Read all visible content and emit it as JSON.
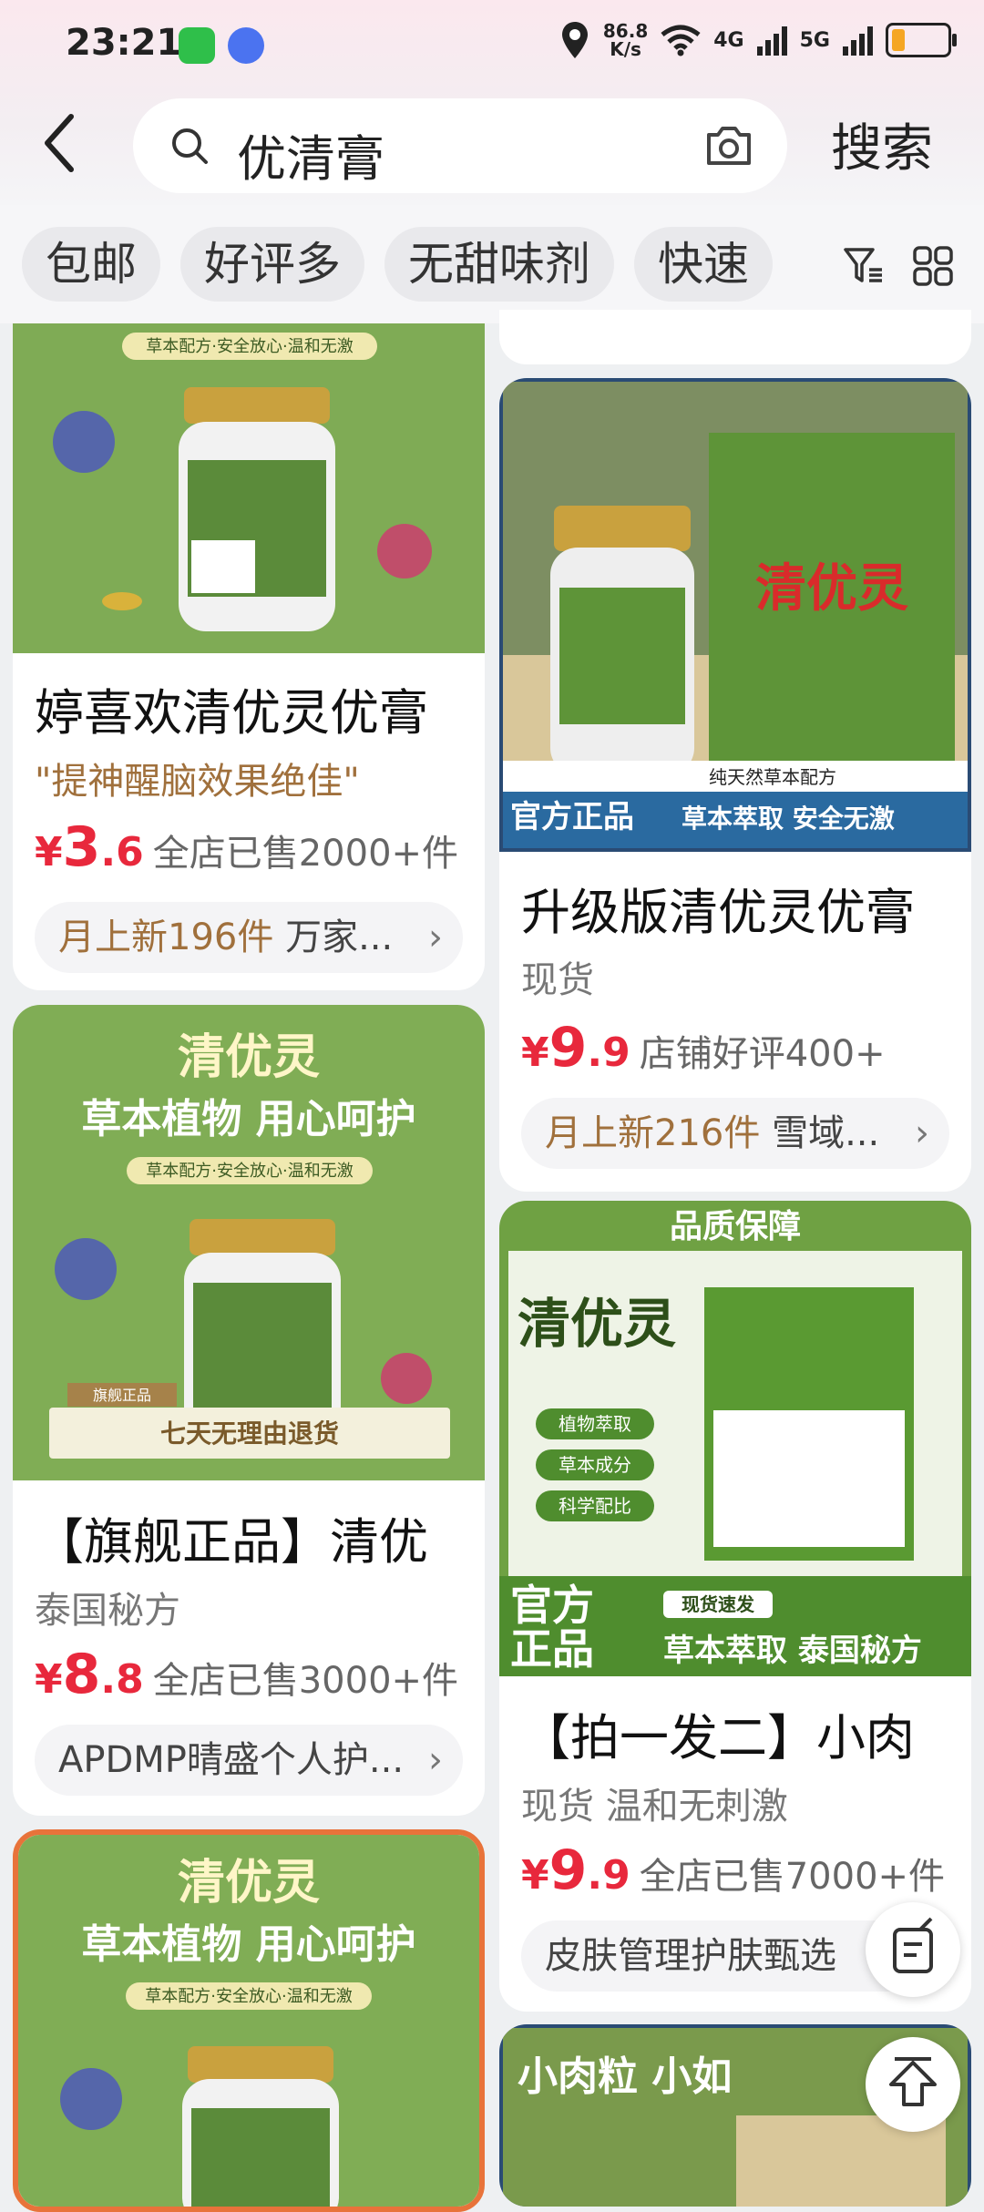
{
  "status_bar": {
    "time": "23:21",
    "speed_value": "86.8",
    "speed_unit": "K/s",
    "net1": "4G",
    "net2": "5G"
  },
  "search": {
    "query": "优清膏",
    "button": "搜索"
  },
  "chips": [
    "包邮",
    "好评多",
    "无甜味剂",
    "快速"
  ],
  "cards": [
    {
      "image_text": "草本配方·安全放心·温和无激",
      "title": "婷喜欢清优灵优膏",
      "subtitle": "\"提神醒脑效果绝佳\"",
      "yen": "¥",
      "price_int": "3",
      "price_dec": ".6",
      "sold": "全店已售2000+件",
      "shop_hl": "月上新196件",
      "shop": " 万家..."
    },
    {
      "image_text1": "纯天然草本配方",
      "image_text2": "官方正品",
      "image_text3": "草本萃取   安全无激",
      "brand_text": "清优灵",
      "title": "升级版清优灵优膏",
      "subtitle": "现货",
      "yen": "¥",
      "price_int": "9",
      "price_dec": ".9",
      "sold": "店铺好评400+",
      "shop_hl": "月上新216件",
      "shop": " 雪域..."
    },
    {
      "image_title": "清优灵",
      "image_slogan": "草本植物  用心呵护",
      "image_text": "草本配方·安全放心·温和无激",
      "image_banner": "七天无理由退货",
      "image_tag": "旗舰正品",
      "title": "【旗舰正品】清优",
      "subtitle": "泰国秘方",
      "yen": "¥",
      "price_int": "8",
      "price_dec": ".8",
      "sold": "全店已售3000+件",
      "shop_hl": "",
      "shop": "APDMP晴盛个人护..."
    },
    {
      "image_head": "品质保障",
      "image_brand": "清优灵",
      "image_bullets": [
        "植物萃取",
        "草本成分",
        "科学配比"
      ],
      "image_tag1": "官方",
      "image_tag2": "正品",
      "image_ship": "现货速发",
      "image_bottom": "草本萃取 泰国秘方",
      "title": "【拍一发二】小肉",
      "subtitle": "现货  温和无刺激",
      "yen": "¥",
      "price_int": "9",
      "price_dec": ".9",
      "sold": "全店已售7000+件",
      "shop_hl": "",
      "shop": "皮肤管理护肤甄选"
    },
    {
      "image_title": "清优灵",
      "image_slogan": "草本植物  用心呵护",
      "image_text": "草本配方·安全放心·温和无激"
    },
    {
      "image_text": "小肉粒   小如"
    }
  ]
}
